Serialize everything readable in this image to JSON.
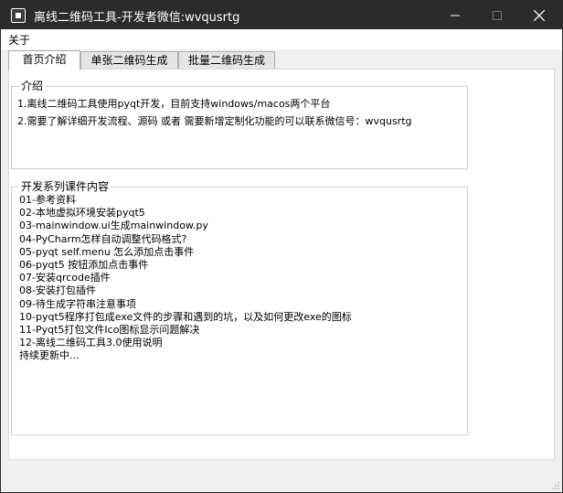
{
  "window": {
    "title": "离线二维码工具-开发者微信:wvqusrtg"
  },
  "menubar": {
    "about": "关于"
  },
  "tabs": [
    {
      "label": "首页介绍",
      "active": true
    },
    {
      "label": "单张二维码生成",
      "active": false
    },
    {
      "label": "批量二维码生成",
      "active": false
    }
  ],
  "intro": {
    "title": "介绍",
    "lines": [
      "1.离线二维码工具使用pyqt开发，目前支持windows/macos两个平台",
      "2.需要了解详细开发流程、源码 或者 需要新增定制化功能的可以联系微信号：wvqusrtg"
    ]
  },
  "course": {
    "title": "开发系列课件内容",
    "items": [
      "01-参考资料",
      "02-本地虚拟环境安装pyqt5",
      "03-mainwindow.ui生成mainwindow.py",
      "04-PyCharm怎样自动调整代码格式?",
      "05-pyqt self.menu 怎么添加点击事件",
      "06-pyqt5 按钮添加点击事件",
      "07-安装qrcode插件",
      "08-安装打包插件",
      "09-待生成字符串注意事项",
      "10-pyqt5程序打包成exe文件的步骤和遇到的坑，以及如何更改exe的图标",
      "11-Pyqt5打包文件Ico图标显示问题解决",
      "12-离线二维码工具3.0使用说明",
      "持续更新中..."
    ]
  }
}
